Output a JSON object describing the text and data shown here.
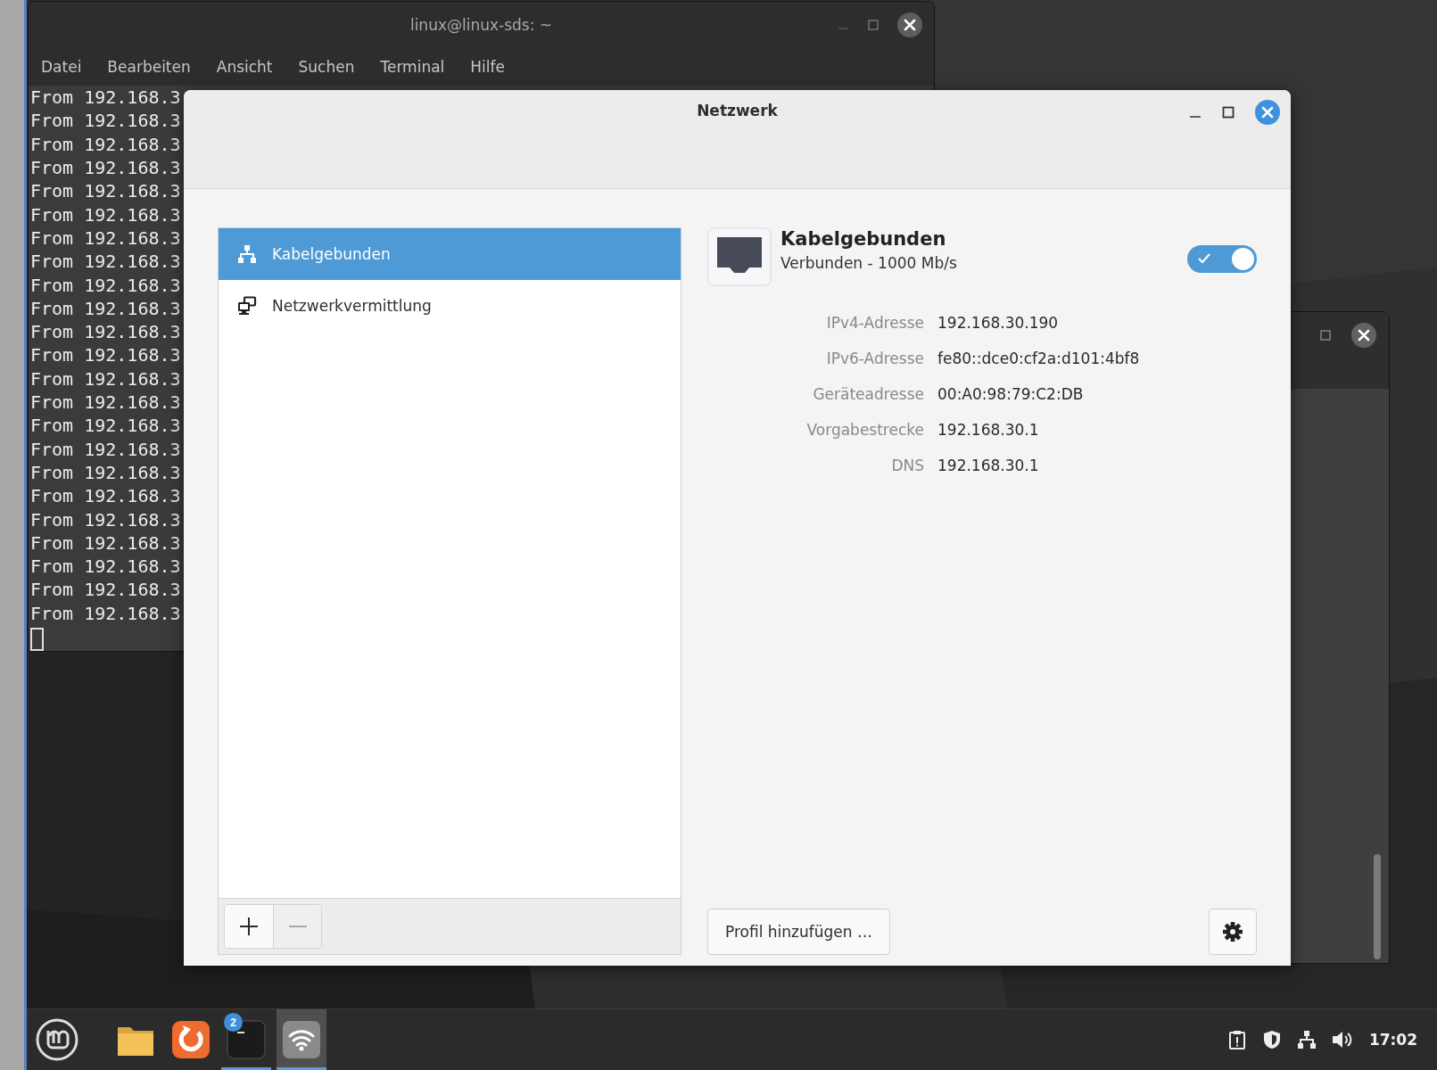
{
  "terminal": {
    "title": "linux@linux-sds: ~",
    "menu": [
      "Datei",
      "Bearbeiten",
      "Ansicht",
      "Suchen",
      "Terminal",
      "Hilfe"
    ],
    "lines": [
      "From 192.168.3",
      "From 192.168.3",
      "From 192.168.3",
      "From 192.168.3",
      "From 192.168.3",
      "From 192.168.3",
      "From 192.168.3",
      "From 192.168.3",
      "From 192.168.3",
      "From 192.168.3",
      "From 192.168.3",
      "From 192.168.3",
      "From 192.168.3",
      "From 192.168.3",
      "From 192.168.3",
      "From 192.168.3",
      "From 192.168.3",
      "From 192.168.3",
      "From 192.168.3",
      "From 192.168.3",
      "From 192.168.3",
      "From 192.168.3",
      "From 192.168.3"
    ]
  },
  "dialog": {
    "title": "Netzwerk",
    "sidebar": {
      "items": [
        {
          "label": "Kabelgebunden",
          "kind": "wired",
          "selected": true
        },
        {
          "label": "Netzwerkvermittlung",
          "kind": "proxy",
          "selected": false
        }
      ],
      "remove_button": {
        "disabled": true
      }
    },
    "detail": {
      "title": "Kabelgebunden",
      "status": "Verbunden - 1000 Mb/s",
      "switch": {
        "on": true
      },
      "properties": [
        {
          "label": "IPv4-Adresse",
          "value": "192.168.30.190"
        },
        {
          "label": "IPv6-Adresse",
          "value": "fe80::dce0:cf2a:d101:4bf8"
        },
        {
          "label": "Geräteadresse",
          "value": "00:A0:98:79:C2:DB"
        },
        {
          "label": "Vorgabestrecke",
          "value": "192.168.30.1"
        },
        {
          "label": "DNS",
          "value": "192.168.30.1"
        }
      ],
      "add_profile_button": "Profil hinzufügen …"
    }
  },
  "taskbar": {
    "apps": [
      {
        "kind": "files",
        "running": false,
        "selected": false
      },
      {
        "kind": "browser",
        "running": false,
        "selected": false
      },
      {
        "kind": "terminal",
        "badge": "2",
        "running": true,
        "selected": false
      },
      {
        "kind": "network",
        "running": true,
        "selected": true
      }
    ],
    "clock": "17:02"
  }
}
